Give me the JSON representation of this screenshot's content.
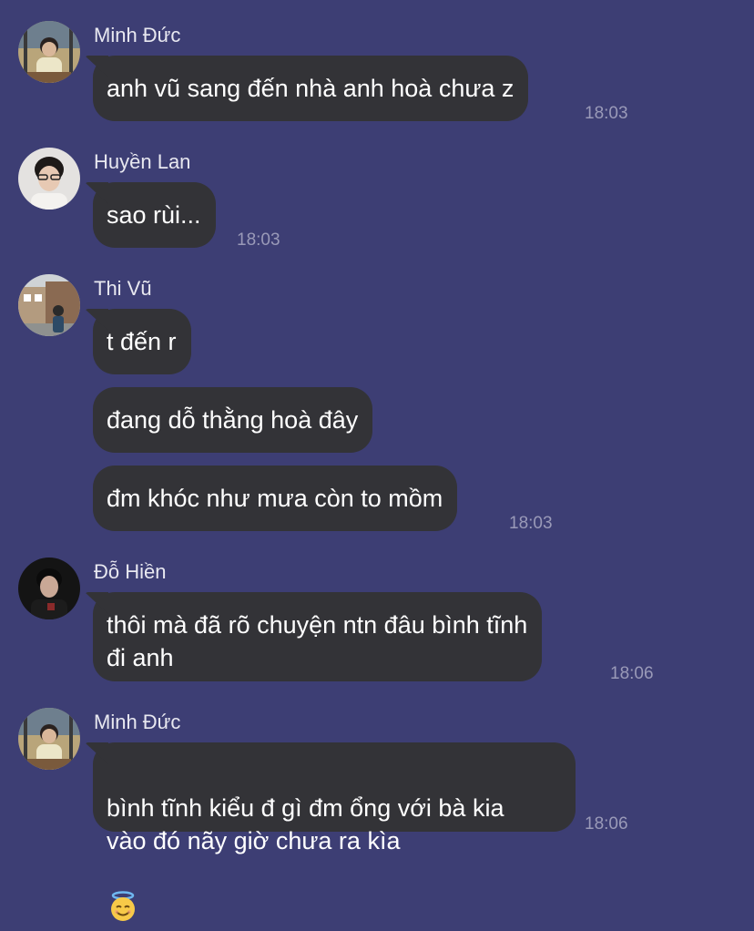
{
  "messages": [
    {
      "sender": "Minh Đức",
      "avatar": "avatar-minh-duc",
      "bubbles": [
        "anh vũ sang đến nhà anh hoà chưa z"
      ],
      "time": "18:03"
    },
    {
      "sender": "Huyền Lan",
      "avatar": "avatar-huyen-lan",
      "bubbles": [
        "sao rùi..."
      ],
      "time": "18:03"
    },
    {
      "sender": "Thi Vũ",
      "avatar": "avatar-thi-vu",
      "bubbles": [
        "t đến r",
        "đang dỗ thằng hoà đây",
        "đm khóc như mưa còn to mồm"
      ],
      "time": "18:03"
    },
    {
      "sender": "Đỗ Hiền",
      "avatar": "avatar-do-hien",
      "bubbles": [
        "thôi mà đã rõ chuyện ntn đâu bình tĩnh\nđi anh"
      ],
      "time": "18:06"
    },
    {
      "sender": "Minh Đức",
      "avatar": "avatar-minh-duc",
      "bubbles": [
        "bình tĩnh kiểu đ gì đm ổng với bà kia\nvào đó nãy giờ chưa ra kìa"
      ],
      "emoji": "smiling-face-with-halo-emoji",
      "time": "18:06"
    }
  ],
  "colors": {
    "background": "#3d3e74",
    "bubble": "#333337",
    "text": "#ffffff",
    "timestamp": "#9a9ab8"
  }
}
